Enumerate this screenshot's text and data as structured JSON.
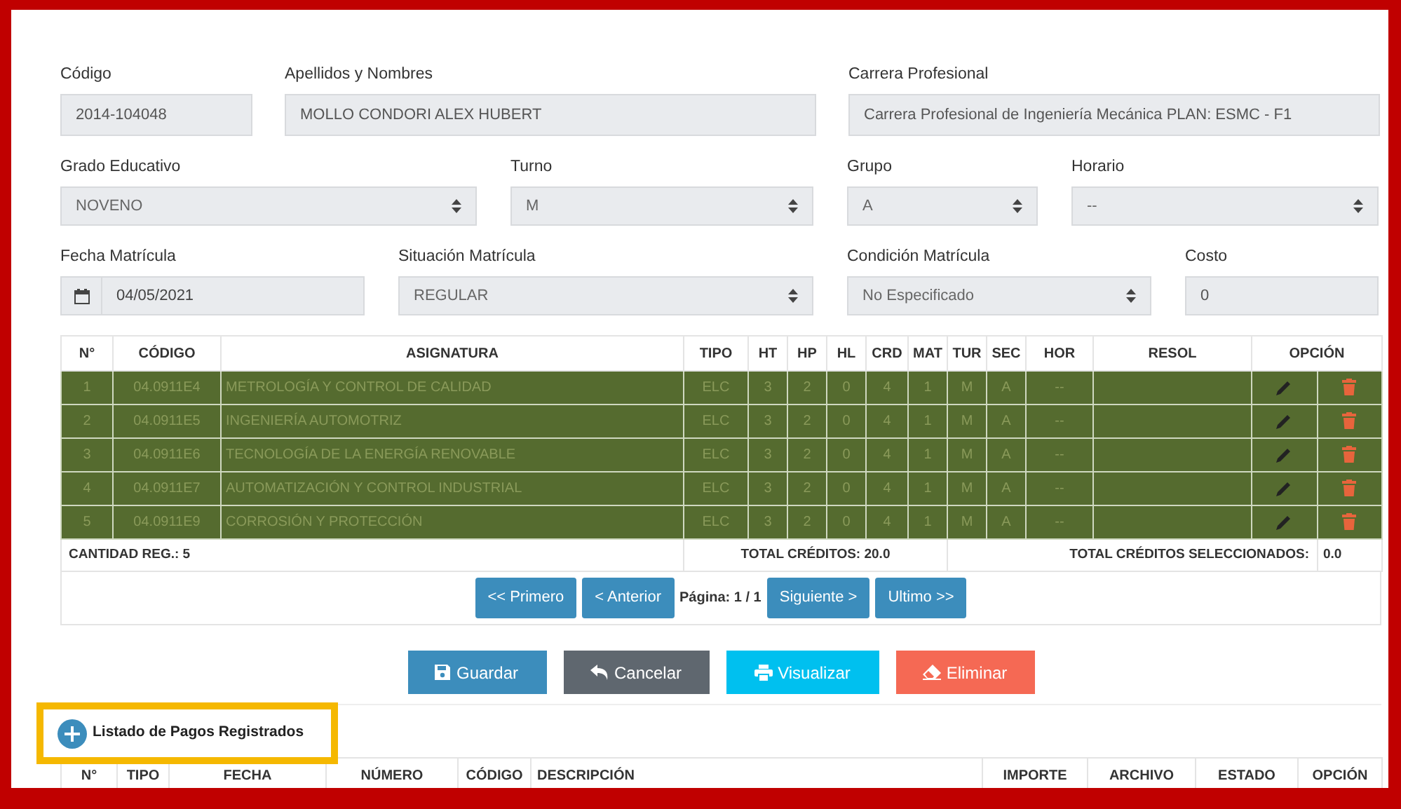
{
  "form": [
    {
      "label": "Código",
      "value": "2014-104048",
      "kind": "text"
    },
    {
      "label": "Apellidos y Nombres",
      "value": "MOLLO CONDORI ALEX HUBERT",
      "kind": "text"
    },
    {
      "label": "Carrera Profesional",
      "value": "Carrera Profesional de Ingeniería Mecánica  PLAN: ESMC - F1",
      "kind": "text"
    },
    {
      "label": "Grado Educativo",
      "value": "NOVENO",
      "kind": "select"
    },
    {
      "label": "Turno",
      "value": "M",
      "kind": "select"
    },
    {
      "label": "Grupo",
      "value": "A",
      "kind": "select"
    },
    {
      "label": "Horario",
      "value": "--",
      "kind": "select"
    },
    {
      "label": "Fecha Matrícula",
      "value": "04/05/2021",
      "kind": "date"
    },
    {
      "label": "Situación Matrícula",
      "value": "REGULAR",
      "kind": "select"
    },
    {
      "label": "Condición Matrícula",
      "value": "No Especificado",
      "kind": "select"
    },
    {
      "label": "Costo",
      "value": "0",
      "kind": "text"
    }
  ],
  "courses": {
    "columns": [
      "N°",
      "CÓDIGO",
      "ASIGNATURA",
      "TIPO",
      "HT",
      "HP",
      "HL",
      "CRD",
      "MAT",
      "TUR",
      "SEC",
      "HOR",
      "RESOL",
      "OPCIÓN"
    ],
    "rows": [
      {
        "selected": true,
        "cells": [
          "1",
          "04.0911E4",
          "METROLOGÍA Y CONTROL DE CALIDAD",
          "ELC",
          "3",
          "2",
          "0",
          "4",
          "1",
          "M",
          "A",
          "--"
        ]
      },
      {
        "selected": true,
        "cells": [
          "2",
          "04.0911E5",
          "INGENIERÍA AUTOMOTRIZ",
          "ELC",
          "3",
          "2",
          "0",
          "4",
          "1",
          "M",
          "A",
          "--"
        ]
      },
      {
        "selected": true,
        "cells": [
          "3",
          "04.0911E6",
          "TECNOLOGÍA DE LA ENERGÍA RENOVABLE",
          "ELC",
          "3",
          "2",
          "0",
          "4",
          "1",
          "M",
          "A",
          "--"
        ]
      },
      {
        "selected": true,
        "cells": [
          "4",
          "04.0911E7",
          "AUTOMATIZACIÓN Y CONTROL INDUSTRIAL",
          "ELC",
          "3",
          "2",
          "0",
          "4",
          "1",
          "M",
          "A",
          "--"
        ]
      },
      {
        "selected": true,
        "cells": [
          "5",
          "04.0911E9",
          "CORROSIÓN Y PROTECCIÓN",
          "ELC",
          "3",
          "2",
          "0",
          "4",
          "1",
          "M",
          "A",
          "--"
        ]
      }
    ],
    "count": "CANTIDAD REG.: 5",
    "total": "TOTAL CRÉDITOS: 20.0",
    "selected_label": "TOTAL CRÉDITOS SELECCIONADOS:",
    "selected_value": "0.0"
  },
  "pagination": {
    "buttons": [
      "<< Primero",
      "< Anterior",
      "Siguiente >",
      "Ultimo >>"
    ],
    "page": "Página: 1 / 1"
  },
  "actions": [
    {
      "label": "Guardar",
      "kind": "save"
    },
    {
      "label": "Cancelar",
      "kind": "cancel"
    },
    {
      "label": "Visualizar",
      "kind": "view"
    },
    {
      "label": "Eliminar",
      "kind": "delete"
    }
  ],
  "payments": {
    "title": "Listado de Pagos Registrados",
    "highlighted": true,
    "columns": [
      "N°",
      "TIPO",
      "FECHA",
      "NÚMERO",
      "CÓDIGO",
      "DESCRIPCIÓN",
      "IMPORTE",
      "ARCHIVO",
      "ESTADO",
      "OPCIÓN"
    ]
  }
}
